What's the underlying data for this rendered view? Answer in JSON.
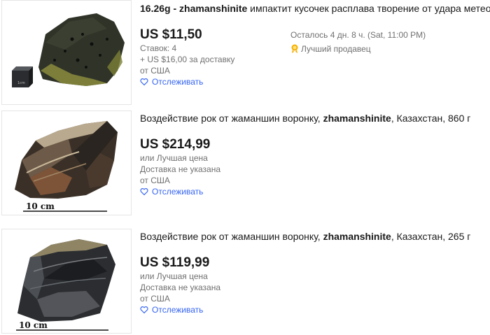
{
  "listings": [
    {
      "title_bold": "16.26g - zhamanshinite",
      "title_rest": " импактит кусочек расплава творение от удара метеорита",
      "price": "US $11,50",
      "bids": "Ставок: 4",
      "shipping": "+ US $16,00 за доставку",
      "origin": "от США",
      "watch": "Отслеживать",
      "time_left": "Осталось 4 дн. 8 ч. (Sat, 11:00 PM)",
      "seller": "Лучший продавец",
      "scale_label": "1cm"
    },
    {
      "title_start": "Воздействие рок от жаманшин воронку, ",
      "title_bold": "zhamanshinite",
      "title_end": ", Казахстан, 860 г",
      "price": "US $214,99",
      "offer": "или Лучшая цена",
      "shipping": "Доставка не указана",
      "origin": "от США",
      "watch": "Отслеживать",
      "scale_label": "10 cm"
    },
    {
      "title_start": "Воздействие рок от жаманшин воронку, ",
      "title_bold": "zhamanshinite",
      "title_end": ", Казахстан, 265 г",
      "price": "US $119,99",
      "offer": "или Лучшая цена",
      "shipping": "Доставка не указана",
      "origin": "от США",
      "watch": "Отслеживать",
      "scale_label": "10 cm"
    }
  ],
  "colors": {
    "link": "#3665f3",
    "muted": "#707070",
    "text": "#191919"
  }
}
